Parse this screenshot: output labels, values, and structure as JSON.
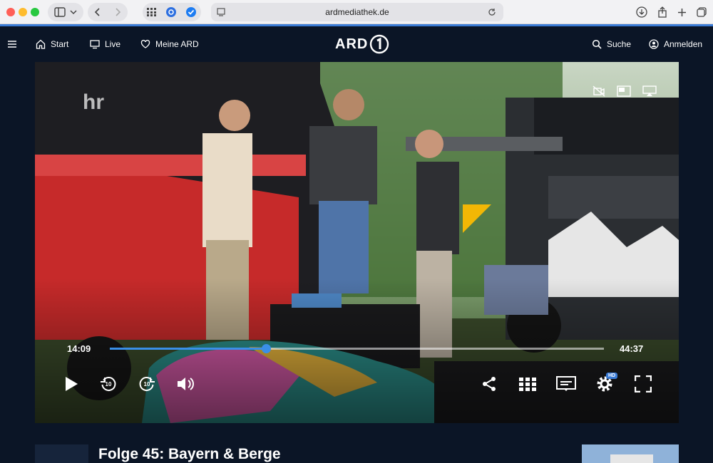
{
  "browser": {
    "url": "ardmediathek.de"
  },
  "nav": {
    "start_label": "Start",
    "live_label": "Live",
    "meine_label": "Meine ARD",
    "logo_text": "ARD",
    "search_label": "Suche",
    "login_label": "Anmelden"
  },
  "player": {
    "channel_watermark": "hr",
    "current_time": "14:09",
    "duration": "44:37",
    "progress_fraction": 0.316,
    "skip_back_seconds": "10",
    "skip_forward_seconds": "10",
    "quality_badge": "HD"
  },
  "episode": {
    "title": "Folge 45: Bayern & Berge"
  },
  "colors": {
    "accent": "#3a7bd5",
    "background": "#0b1526",
    "progress": "#3a8fe8"
  }
}
